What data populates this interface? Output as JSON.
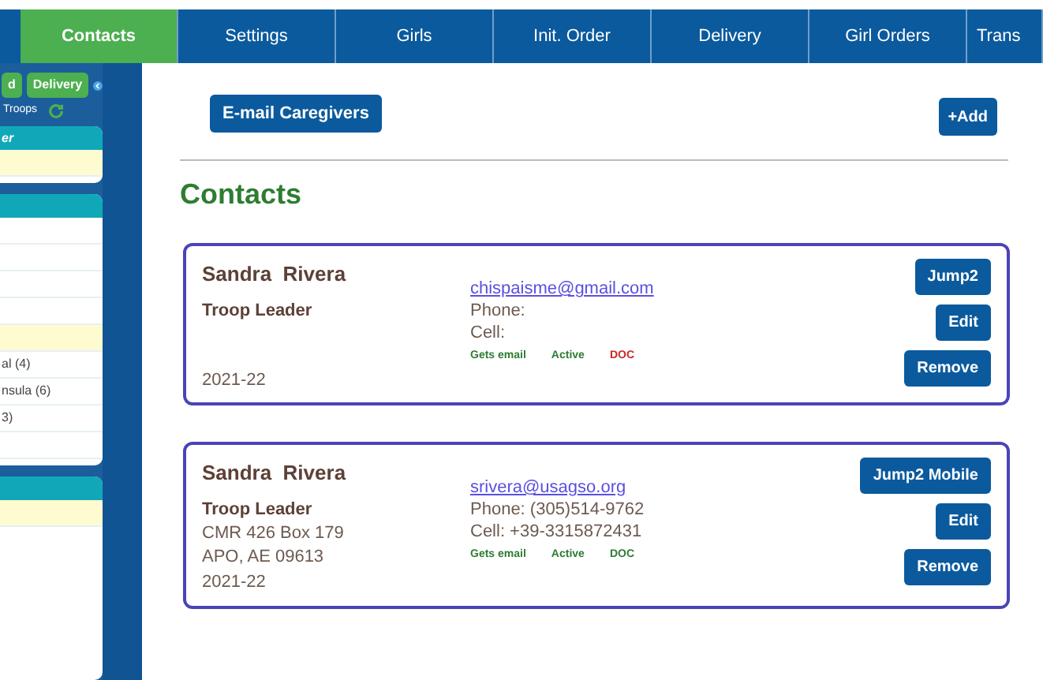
{
  "tabs": [
    {
      "label": "Contacts",
      "selected": true
    },
    {
      "label": "Settings",
      "selected": false
    },
    {
      "label": "Girls",
      "selected": false
    },
    {
      "label": "Init. Order",
      "selected": false
    },
    {
      "label": "Delivery",
      "selected": false
    },
    {
      "label": "Girl Orders",
      "selected": false
    },
    {
      "label": "Trans",
      "selected": false
    }
  ],
  "sidebar": {
    "buttons": [
      "d",
      "Delivery"
    ],
    "troops_label": "Troops",
    "panels": [
      {
        "header": "er",
        "rows": [
          {
            "highlight": true
          }
        ]
      },
      {
        "rows": [
          {
            "highlight": false
          },
          {
            "highlight": false
          },
          {
            "highlight": false
          },
          {
            "highlight": false
          },
          {
            "highlight": true
          },
          {
            "text": "al (4)",
            "highlight": false
          },
          {
            "text": "nsula (6)",
            "highlight": false
          },
          {
            "text": "3)",
            "highlight": false
          },
          {
            "highlight": false
          }
        ]
      },
      {
        "rows": [
          {
            "highlight": true
          }
        ]
      }
    ]
  },
  "toolbar": {
    "email_button": "E-mail Caregivers",
    "add_button": "+Add"
  },
  "heading": "Contacts",
  "contacts": [
    {
      "name": "Sandra  Rivera",
      "role": "Troop Leader",
      "year": "2021-22",
      "email": "chispaisme@gmail.com",
      "phone": "Phone:",
      "cell": "Cell:",
      "tags": [
        {
          "label": "Gets email",
          "color": "#2e7d32"
        },
        {
          "label": "Active",
          "color": "#2e7d32"
        },
        {
          "label": "DOC",
          "color": "#c62828"
        }
      ],
      "buttons": [
        "Jump2",
        "Edit",
        "Remove"
      ]
    },
    {
      "name": "Sandra  Rivera",
      "role": "Troop Leader",
      "address": [
        "CMR 426 Box 179",
        "APO, AE 09613"
      ],
      "year": "2021-22",
      "email": "srivera@usagso.org",
      "phone": "Phone: (305)514-9762",
      "cell": "Cell: +39-3315872431",
      "tags": [
        {
          "label": "Gets email",
          "color": "#2e7d32"
        },
        {
          "label": "Active",
          "color": "#2e7d32"
        },
        {
          "label": "DOC",
          "color": "#2e7d32"
        }
      ],
      "buttons": [
        "Jump2 Mobile",
        "Edit",
        "Remove"
      ]
    }
  ]
}
